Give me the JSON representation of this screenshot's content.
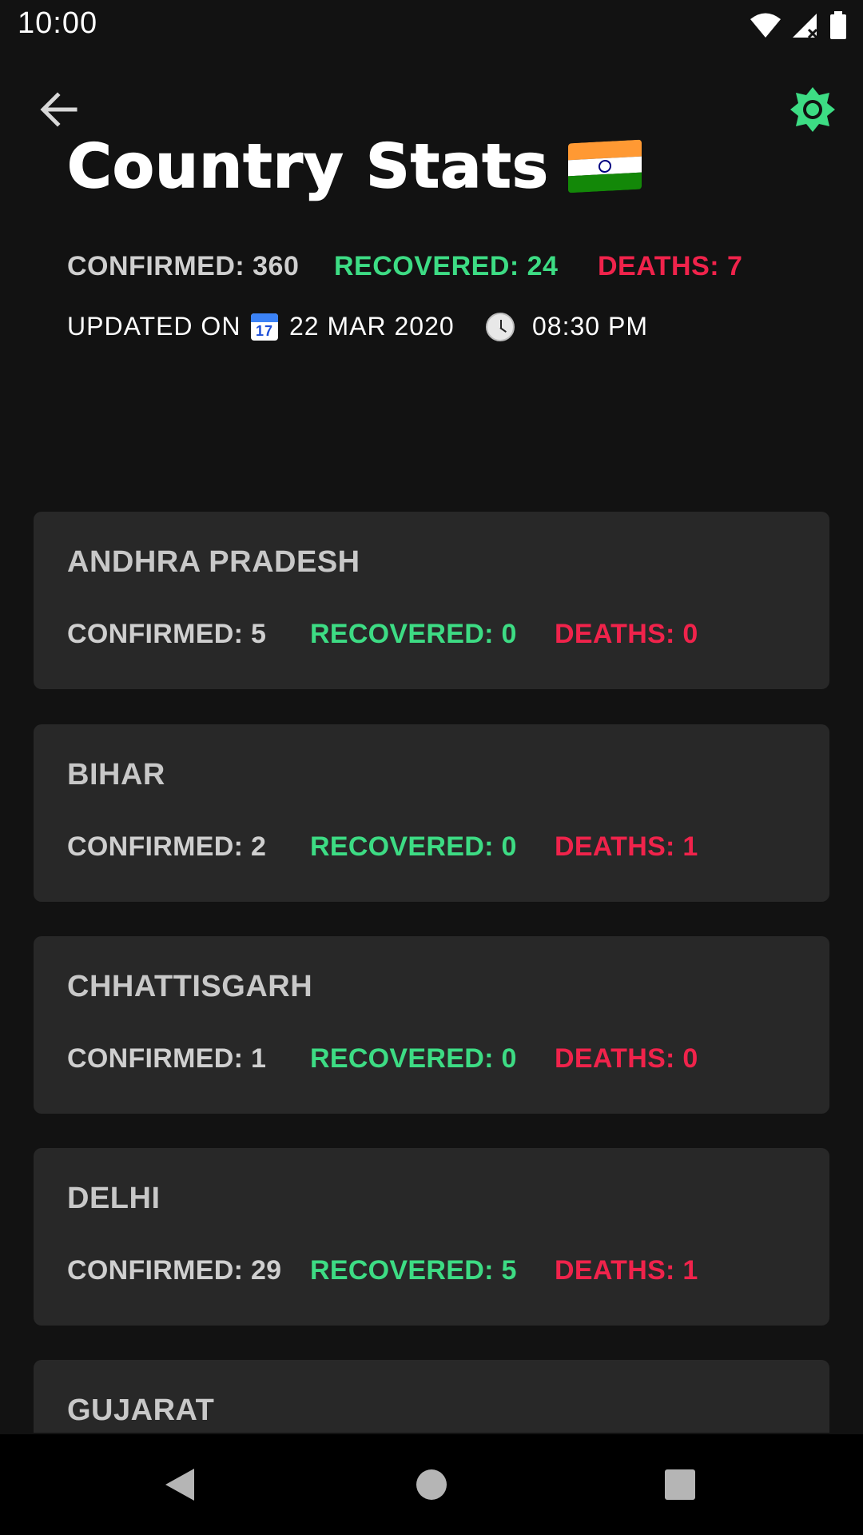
{
  "status_bar": {
    "time": "10:00",
    "icons": [
      "wifi-icon",
      "signal-icon",
      "battery-icon"
    ]
  },
  "header": {
    "title": "Country Stats",
    "flag": "india-flag-icon"
  },
  "summary": {
    "confirmed": "CONFIRMED: 360",
    "recovered": "RECOVERED: 24",
    "deaths": "DEATHS: 7"
  },
  "updated": {
    "label": "UPDATED ON",
    "calendar_day": "17",
    "date": "22 MAR 2020",
    "time": "08:30 PM"
  },
  "colors": {
    "accent": "#3ddc84",
    "recovered": "#3ddc84",
    "deaths": "#f0234b",
    "card_bg": "#282828",
    "background": "#121212"
  },
  "states": [
    {
      "name": "ANDHRA PRADESH",
      "confirmed": "CONFIRMED: 5",
      "recovered": "RECOVERED: 0",
      "deaths": "DEATHS: 0"
    },
    {
      "name": "BIHAR",
      "confirmed": "CONFIRMED: 2",
      "recovered": "RECOVERED: 0",
      "deaths": "DEATHS: 1"
    },
    {
      "name": "CHHATTISGARH",
      "confirmed": "CONFIRMED: 1",
      "recovered": "RECOVERED: 0",
      "deaths": "DEATHS: 0"
    },
    {
      "name": "DELHI",
      "confirmed": "CONFIRMED: 29",
      "recovered": "RECOVERED: 5",
      "deaths": "DEATHS: 1"
    },
    {
      "name": "GUJARAT",
      "confirmed": "",
      "recovered": "",
      "deaths": ""
    }
  ],
  "nav": {
    "back": "back-triangle-icon",
    "home": "home-circle-icon",
    "recents": "recents-square-icon"
  }
}
